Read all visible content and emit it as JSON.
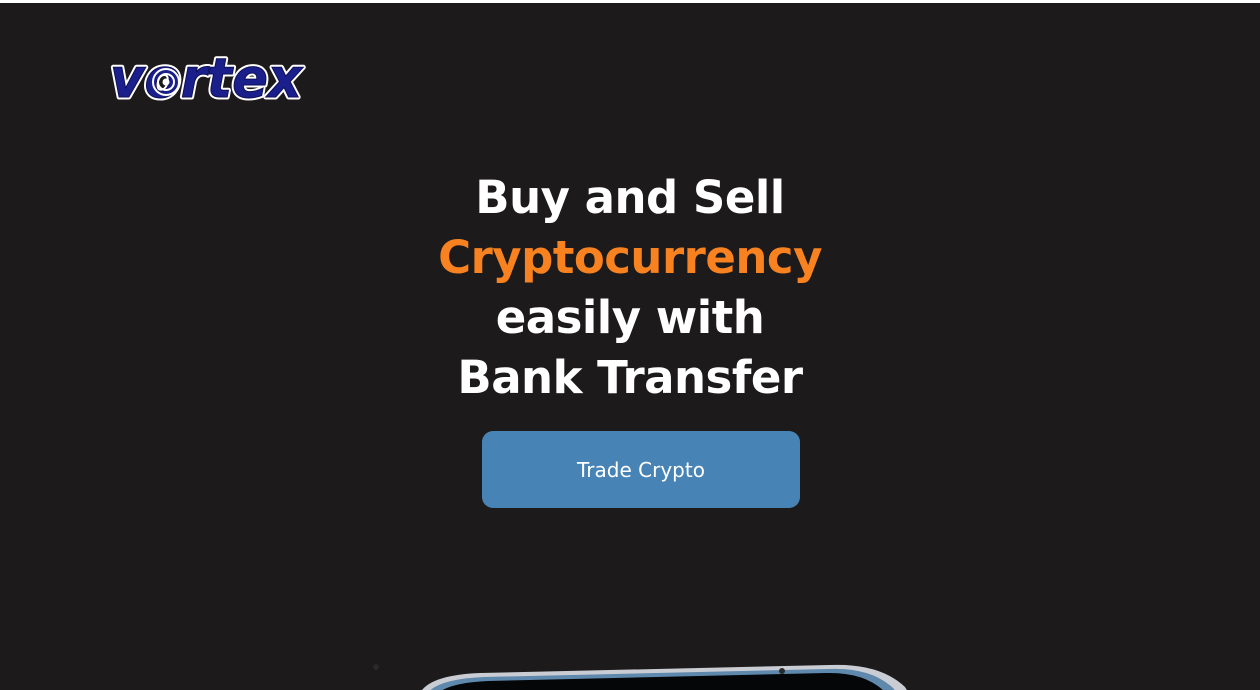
{
  "brand": {
    "name": "vortex",
    "colors": {
      "primary": "#1a1f8c",
      "outline": "#ffffff"
    }
  },
  "hero": {
    "line1": "Buy and Sell",
    "line2": "Cryptocurrency",
    "line3": "easily with",
    "line4": "Bank Transfer"
  },
  "cta": {
    "label": "Trade Crypto"
  },
  "colors": {
    "background": "#1c1a1b",
    "accent": "#f7821f",
    "button": "#4883b6",
    "text": "#ffffff"
  },
  "images": {
    "phone": "phone-mockup"
  }
}
